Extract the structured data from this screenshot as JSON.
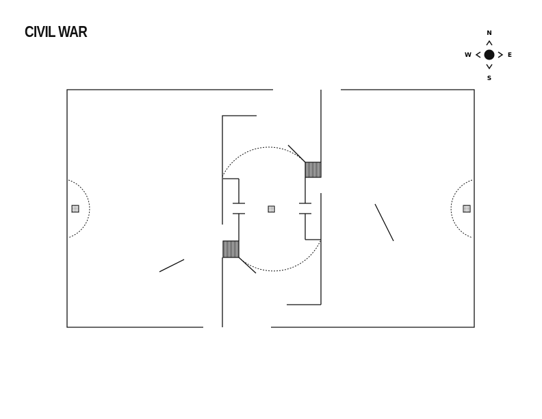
{
  "title": "CIVIL WAR",
  "compass": {
    "north": "N",
    "south": "S",
    "east": "E",
    "west": "W"
  },
  "colors": {
    "ink": "#111111",
    "background": "#ffffff"
  },
  "icons": [
    "compass-rose-icon",
    "control-point-icon",
    "spawn-room-icon"
  ]
}
